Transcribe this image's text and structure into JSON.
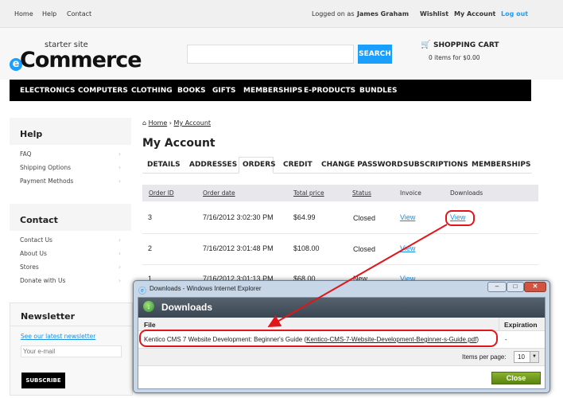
{
  "topbar": {
    "home": "Home",
    "help": "Help",
    "contact": "Contact",
    "logged_on_as": "Logged on as",
    "user": "James Graham",
    "wishlist": "Wishlist",
    "my_account": "My Account",
    "logout": "Log out"
  },
  "header": {
    "logo_small": "starter site",
    "logo_main": "Commerce",
    "logo_e": "e",
    "search_placeholder": "",
    "search_label": "SEARCH",
    "cart_title": "SHOPPING CART",
    "cart_summary": "0 items for $0.00"
  },
  "nav": [
    "ELECTRONICS",
    "COMPUTERS",
    "CLOTHING",
    "BOOKS",
    "GIFTS",
    "MEMBERSHIPS",
    "E-PRODUCTS",
    "BUNDLES"
  ],
  "sidebar": {
    "help": {
      "title": "Help",
      "items": [
        "FAQ",
        "Shipping Options",
        "Payment Methods"
      ]
    },
    "contact": {
      "title": "Contact",
      "items": [
        "Contact Us",
        "About Us",
        "Stores",
        "Donate with Us"
      ]
    },
    "newsletter": {
      "title": "Newsletter",
      "link": "See our latest newsletter",
      "email_placeholder": "Your e-mail",
      "subscribe": "SUBSCRIBE"
    }
  },
  "main": {
    "breadcrumb": [
      "Home",
      "My Account"
    ],
    "title": "My Account",
    "tabs": [
      "DETAILS",
      "ADDRESSES",
      "ORDERS",
      "CREDIT",
      "CHANGE PASSWORD",
      "SUBSCRIPTIONS",
      "MEMBERSHIPS"
    ],
    "active_tab": "ORDERS",
    "table": {
      "headers": [
        "Order ID",
        "Order date",
        "Total price",
        "Status",
        "Invoice",
        "Downloads"
      ],
      "rows": [
        {
          "id": "3",
          "date": "7/16/2012 3:02:30 PM",
          "price": "$64.99",
          "status": "Closed",
          "invoice": "View",
          "downloads": "View"
        },
        {
          "id": "2",
          "date": "7/16/2012 3:01:48 PM",
          "price": "$108.00",
          "status": "Closed",
          "invoice": "View",
          "downloads": ""
        },
        {
          "id": "1",
          "date": "7/16/2012 3:01:13 PM",
          "price": "$68.00",
          "status": "New",
          "invoice": "View",
          "downloads": ""
        }
      ]
    }
  },
  "popup": {
    "window_title": "Downloads - Windows Internet Explorer",
    "heading": "Downloads",
    "col_file": "File",
    "col_expiration": "Expiration",
    "file_name": "Kentico CMS 7 Website Development: Beginner's Guide",
    "file_link": "Kentico-CMS-7-Website-Development-Beginner-s-Guide.pdf",
    "expiration": "-",
    "items_per_page_label": "Items per page:",
    "items_per_page": "10",
    "close": "Close"
  },
  "colors": {
    "accent": "#1a9fff",
    "annotation": "#e0161b",
    "close_button": "#6b9418"
  }
}
